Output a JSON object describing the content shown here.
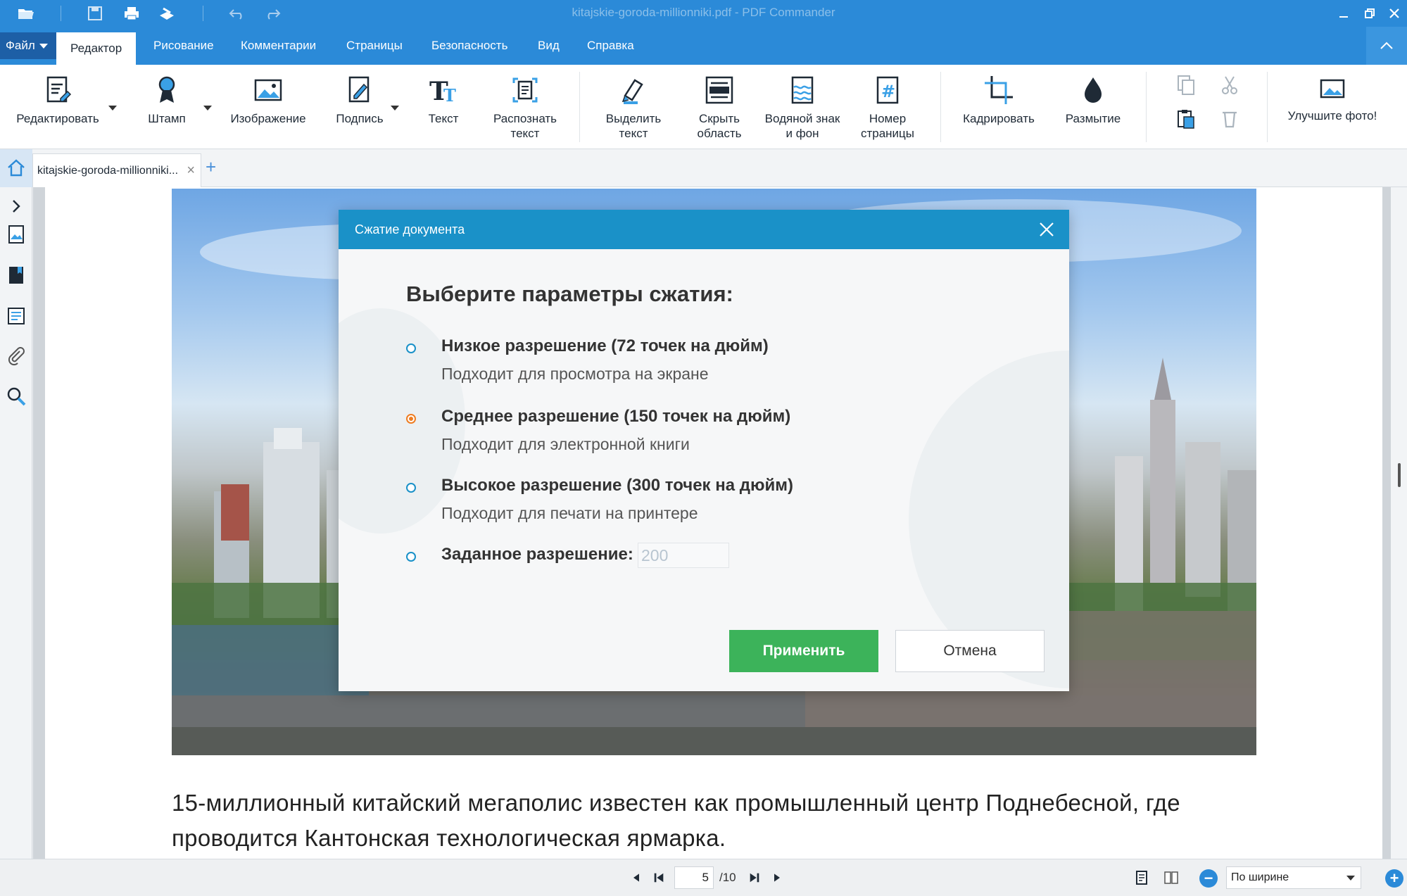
{
  "window": {
    "title": "kitajskie-goroda-millionniki.pdf - PDF Commander"
  },
  "menu": {
    "file": "Файл",
    "items": [
      "Редактор",
      "Рисование",
      "Комментарии",
      "Страницы",
      "Безопасность",
      "Вид",
      "Справка"
    ]
  },
  "ribbon": {
    "edit": "Редактировать",
    "stamp": "Штамп",
    "image": "Изображение",
    "signature": "Подпись",
    "text": "Текст",
    "ocr": "Распознать\nтекст",
    "highlight": "Выделить\nтекст",
    "hide_area": "Скрыть\nобласть",
    "watermark": "Водяной знак\nи фон",
    "page_number": "Номер\nстраницы",
    "crop": "Кадрировать",
    "blur": "Размытие",
    "improve_photo": "Улучшите фото!"
  },
  "tabs": {
    "doc_tab": "kitajskie-goroda-millionniki..."
  },
  "document": {
    "body_text": "15-миллионный китайский мегаполис известен как промышленный центр Поднебесной, где проводится Кантонская технологическая ярмарка."
  },
  "dialog": {
    "title": "Сжатие документа",
    "heading": "Выберите параметры сжатия:",
    "options": [
      {
        "label": "Низкое разрешение (72 точек на дюйм)",
        "sub": "Подходит для просмотра на экране",
        "checked": false
      },
      {
        "label": "Среднее разрешение (150 точек на дюйм)",
        "sub": "Подходит для электронной книги",
        "checked": true
      },
      {
        "label": "Высокое разрешение (300 точек на дюйм)",
        "sub": "Подходит для печати на принтере",
        "checked": false
      },
      {
        "label": "Заданное разрешение:",
        "sub": "",
        "checked": false
      }
    ],
    "custom_value_placeholder": "200",
    "apply": "Применить",
    "cancel": "Отмена"
  },
  "status": {
    "current_page": "5",
    "total_pages": "/10",
    "zoom_mode": "По ширине"
  },
  "colors": {
    "accent": "#2b8ad8",
    "dialog_header": "#1a91c8",
    "apply_button": "#3cb35a",
    "radio_selected": "#ef7d22"
  }
}
